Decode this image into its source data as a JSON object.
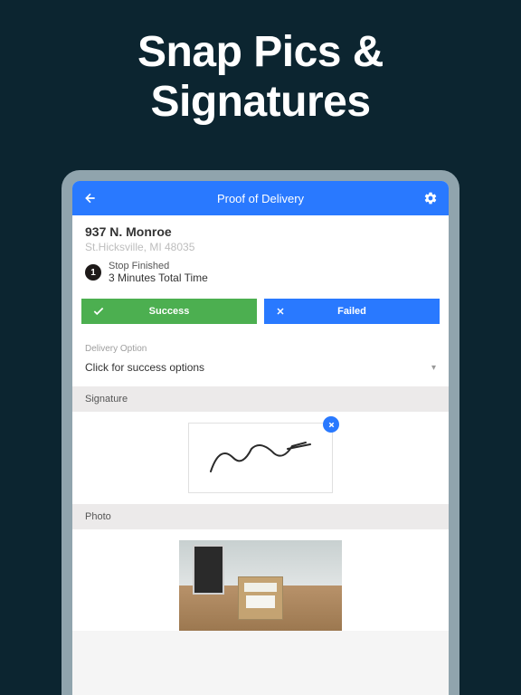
{
  "hero": {
    "line1": "Snap Pics &",
    "line2": "Signatures"
  },
  "header": {
    "title": "Proof of Delivery"
  },
  "address": {
    "street": "937 N. Monroe",
    "cityState": "St.Hicksville, MI 48035"
  },
  "step": {
    "number": "1",
    "label": "Stop Finished",
    "time": "3 Minutes Total Time"
  },
  "buttons": {
    "success": "Success",
    "failed": "Failed"
  },
  "delivery": {
    "label": "Delivery Option",
    "value": "Click for success options"
  },
  "sections": {
    "signature": "Signature",
    "photo": "Photo"
  }
}
